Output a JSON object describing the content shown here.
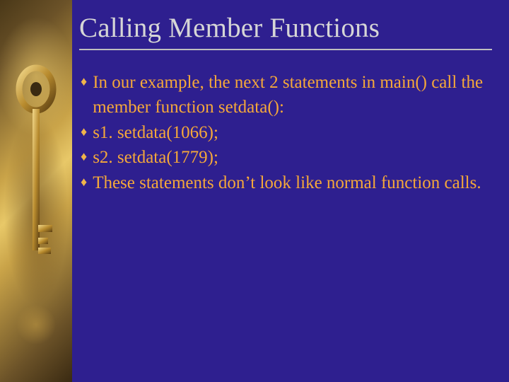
{
  "slide": {
    "title": "Calling Member Functions",
    "bullets": [
      "In our example, the next 2 statements in main() call the member function setdata():",
      "s1. setdata(1066);",
      "s2. setdata(1779);",
      "These statements don’t look like normal function calls."
    ]
  },
  "icons": {
    "bullet_glyph": "♦"
  },
  "colors": {
    "background": "#2e1f8f",
    "title": "#d6d6d6",
    "body_text": "#f5a83a",
    "rule": "#bfbfbf"
  }
}
